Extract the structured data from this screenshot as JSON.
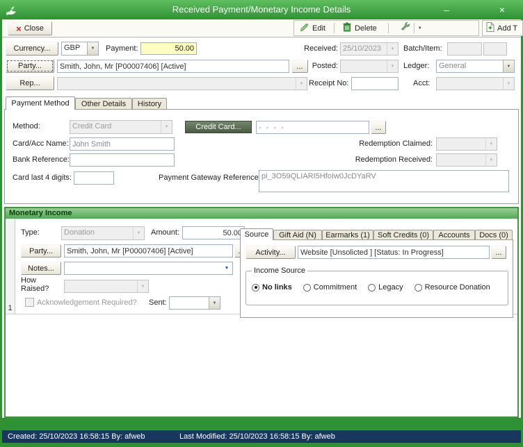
{
  "window": {
    "title": "Received Payment/Monetary Income Details",
    "minimize_glyph": "–",
    "close_glyph": "×"
  },
  "icons": {
    "close_x": "×",
    "ellipsis": "..."
  },
  "toolbar": {
    "close_label": "Close",
    "edit_label": "Edit",
    "delete_label": "Delete",
    "add_label": "Add T"
  },
  "header": {
    "currency_button": "Currency...",
    "currency_value": "GBP",
    "payment_label": "Payment:",
    "payment_value": "50.00",
    "received_label": "Received:",
    "received_value": "25/10/2023",
    "batch_item_label": "Batch/Item:",
    "party_button": "Party...",
    "party_value": "Smith, John, Mr  [P00007406]  [Active]",
    "posted_label": "Posted:",
    "ledger_label": "Ledger:",
    "ledger_value": "General",
    "rep_button": "Rep...",
    "receipt_no_label": "Receipt No:",
    "acct_label": "Acct:"
  },
  "payment_tabs": [
    "Payment Method",
    "Other Details",
    "History"
  ],
  "payment_method": {
    "method_label": "Method:",
    "method_value": "Credit Card",
    "credit_card_button": "Credit Card...",
    "card_number_mask": "-   -   -   -",
    "card_acc_name_label": "Card/Acc Name:",
    "card_acc_name_value": "John Smith",
    "bank_reference_label": "Bank Reference:",
    "redemption_claimed_label": "Redemption Claimed:",
    "redemption_received_label": "Redemption Received:",
    "card_last4_label": "Card last 4 digits:",
    "gateway_label": "Payment Gateway Reference:",
    "gateway_value": "pi_3O59QLIARI5HfoIw0JcDYaRV"
  },
  "monetary_income": {
    "section_title": "Monetary Income",
    "row_number": "1",
    "type_label": "Type:",
    "type_value": "Donation",
    "amount_label": "Amount:",
    "amount_value": "50.00",
    "party_button": "Party...",
    "party_value": "Smith, John, Mr  [P00007406]  [Active]",
    "notes_button": "Notes...",
    "how_raised_label": "How Raised?",
    "ack_required_label": "Acknowledgement Required?",
    "sent_label": "Sent:",
    "tabs": [
      "Source",
      "Gift Aid (N)",
      "Earmarks (1)",
      "Soft Credits (0)",
      "Accounts",
      "Docs (0)"
    ],
    "source": {
      "activity_button": "Activity...",
      "activity_value": "Website [Unsolicted ] [Status: In Progress]",
      "group_label": "Income Source",
      "radio_options": [
        "No links",
        "Commitment",
        "Legacy",
        "Resource Donation"
      ],
      "selected_index": 0
    }
  },
  "statusbar": {
    "created": "Created: 25/10/2023 16:58:15  By: afweb",
    "last_modified": "Last Modified: 25/10/2023 16:58:15  By: afweb"
  }
}
